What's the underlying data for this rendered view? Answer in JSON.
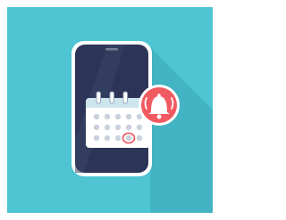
{
  "illustration": {
    "subject": "phone-calendar-reminder",
    "icons": [
      "smartphone-icon",
      "calendar-icon",
      "bell-icon"
    ],
    "colors": {
      "background": "#4fc4d3",
      "phone_frame": "#ffffff",
      "phone_screen": "#2c3558",
      "screen_shine": "#3a4468",
      "calendar_body": "#ffffff",
      "calendar_header": "#cde6ee",
      "calendar_dots": "#c9d2dc",
      "calendar_rings": "#ffffff",
      "marked_day": "#e9525b",
      "badge": "#f15a60",
      "badge_ring": "#ffffff",
      "bell": "#ffffff",
      "shadow": "#3aa8b7"
    }
  }
}
